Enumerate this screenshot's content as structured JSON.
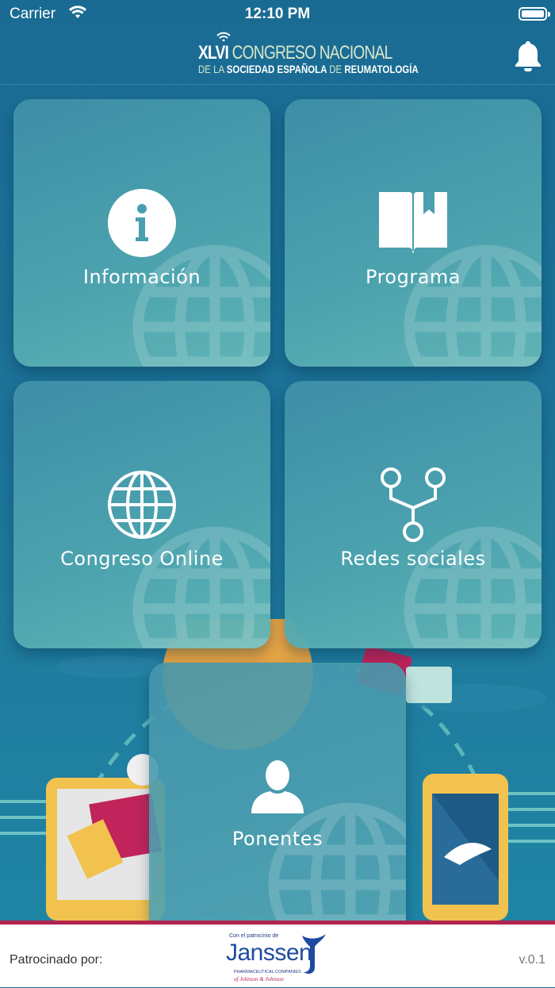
{
  "status_bar": {
    "carrier": "Carrier",
    "time": "12:10 PM"
  },
  "header": {
    "logo": {
      "line1_prefix": "XLVI",
      "line1_rest": " CONGRESO NACIONAL",
      "line2_a": "DE LA ",
      "line2_b": "SOCIEDAD ESPAÑOLA ",
      "line2_c": "DE ",
      "line2_d": "REUMATOLOGÍA"
    },
    "notification_icon": "bell-icon"
  },
  "menu": {
    "informacion": {
      "label": "Información",
      "icon": "info-icon"
    },
    "programa": {
      "label": "Programa",
      "icon": "book-icon"
    },
    "congreso_online": {
      "label": "Congreso Online",
      "icon": "globe-icon"
    },
    "redes_sociales": {
      "label": "Redes sociales",
      "icon": "share-network-icon"
    },
    "ponentes": {
      "label": "Ponentes",
      "icon": "person-icon"
    }
  },
  "footer": {
    "sponsored_label": "Patrocinado por:",
    "sponsor": {
      "small_text": "Con el patrocinio de",
      "name": "Janssen",
      "sub": "PHARMACEUTICAL COMPANIES",
      "parent": "of Johnson & Johnson"
    },
    "version": "v.0.1"
  },
  "colors": {
    "background": "#1c6e95",
    "tile": "#4aa0ae",
    "footer_accent": "#b2244f",
    "sponsor_blue": "#1f4aa0"
  }
}
